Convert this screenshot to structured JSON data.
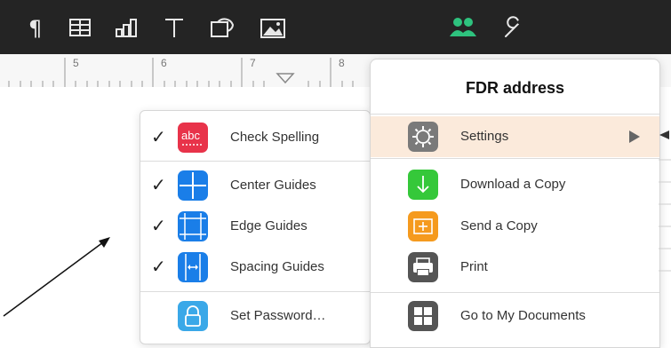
{
  "toolbar": {
    "icons": [
      "paragraph-icon",
      "table-icon",
      "chart-icon",
      "text-icon",
      "shape-icon",
      "image-icon",
      "collaborate-icon",
      "tools-wrench-icon"
    ]
  },
  "ruler": {
    "numbers": [
      "5",
      "6",
      "7",
      "8"
    ]
  },
  "view_popover": {
    "items": [
      {
        "label": "Check Spelling",
        "checked": true,
        "icon": "abc-spelling-icon",
        "color": "#e8334a",
        "icon_text": "abc"
      },
      {
        "label": "Center Guides",
        "checked": true,
        "icon": "center-guides-icon",
        "color": "#1a7ee8"
      },
      {
        "label": "Edge Guides",
        "checked": true,
        "icon": "edge-guides-icon",
        "color": "#1a7ee8"
      },
      {
        "label": "Spacing Guides",
        "checked": true,
        "icon": "spacing-guides-icon",
        "color": "#1a7ee8"
      },
      {
        "label": "Set Password…",
        "checked": false,
        "icon": "lock-icon",
        "color": "#3aa8e8"
      }
    ]
  },
  "tools_popover": {
    "title": "FDR address",
    "items": [
      {
        "label": "Settings",
        "icon": "gear-icon",
        "color": "#7a7a7a",
        "selected": true,
        "has_submenu": true
      },
      {
        "label": "Download a Copy",
        "icon": "download-icon",
        "color": "#35c83a"
      },
      {
        "label": "Send a Copy",
        "icon": "send-copy-icon",
        "color": "#f59a1e"
      },
      {
        "label": "Print",
        "icon": "printer-icon",
        "color": "#555555"
      },
      {
        "label": "Go to My Documents",
        "icon": "documents-grid-icon",
        "color": "#555555"
      }
    ]
  },
  "colors": {
    "toolbar_bg": "#242424",
    "accent_green": "#2ec27e",
    "selected_row": "#fbeadb"
  }
}
